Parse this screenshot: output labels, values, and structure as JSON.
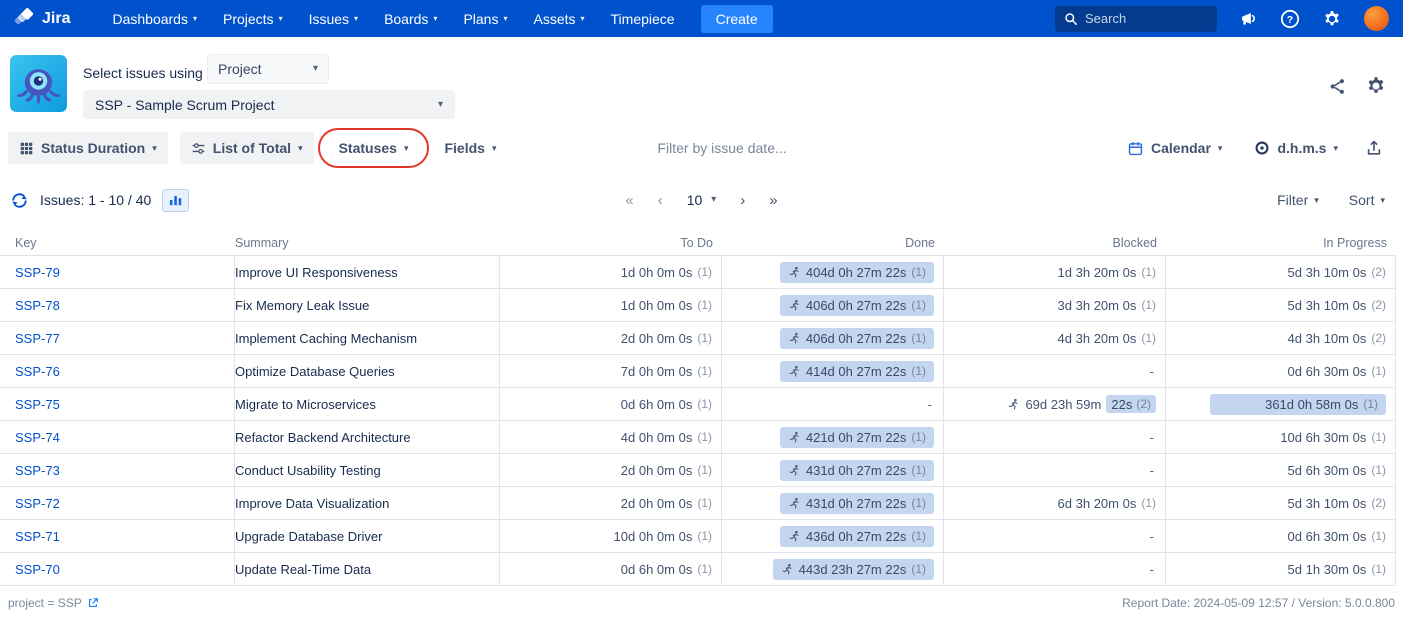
{
  "nav": {
    "brand": "Jira",
    "items": [
      {
        "label": "Dashboards",
        "dropdown": true
      },
      {
        "label": "Projects",
        "dropdown": true
      },
      {
        "label": "Issues",
        "dropdown": true
      },
      {
        "label": "Boards",
        "dropdown": true
      },
      {
        "label": "Plans",
        "dropdown": true
      },
      {
        "label": "Assets",
        "dropdown": true
      },
      {
        "label": "Timepiece",
        "dropdown": false
      }
    ],
    "create_label": "Create",
    "search_placeholder": "Search"
  },
  "header": {
    "select_issues_label": "Select issues using",
    "issue_source": "Project",
    "project": "SSP - Sample Scrum Project"
  },
  "toolbar": {
    "status_duration": "Status Duration",
    "list_of_total": "List of Total",
    "statuses": "Statuses",
    "fields": "Fields",
    "date_filter_placeholder": "Filter by issue date...",
    "calendar": "Calendar",
    "time_format": "d.h.m.s"
  },
  "pagination": {
    "issues_label": "Issues: 1 - 10 / 40",
    "page_size": "10",
    "filter_label": "Filter",
    "sort_label": "Sort"
  },
  "table": {
    "columns": [
      "Key",
      "Summary",
      "To Do",
      "Done",
      "Blocked",
      "In Progress"
    ],
    "rows": [
      {
        "key": "SSP-79",
        "summary": "Improve UI Responsiveness",
        "todo": {
          "text": "1d 0h 0m 0s",
          "count": "(1)"
        },
        "done": {
          "text": "404d 0h 27m 22s",
          "count": "(1)",
          "runner": true,
          "pill": "blue"
        },
        "blocked": {
          "text": "1d 3h 20m 0s",
          "count": "(1)"
        },
        "in_progress": {
          "text": "5d 3h 10m 0s",
          "count": "(2)"
        }
      },
      {
        "key": "SSP-78",
        "summary": "Fix Memory Leak Issue",
        "todo": {
          "text": "1d 0h 0m 0s",
          "count": "(1)"
        },
        "done": {
          "text": "406d 0h 27m 22s",
          "count": "(1)",
          "runner": true,
          "pill": "blue"
        },
        "blocked": {
          "text": "3d 3h 20m 0s",
          "count": "(1)"
        },
        "in_progress": {
          "text": "5d 3h 10m 0s",
          "count": "(2)"
        }
      },
      {
        "key": "SSP-77",
        "summary": "Implement Caching Mechanism",
        "todo": {
          "text": "2d 0h 0m 0s",
          "count": "(1)"
        },
        "done": {
          "text": "406d 0h 27m 22s",
          "count": "(1)",
          "runner": true,
          "pill": "blue"
        },
        "blocked": {
          "text": "4d 3h 20m 0s",
          "count": "(1)"
        },
        "in_progress": {
          "text": "4d 3h 10m 0s",
          "count": "(2)"
        }
      },
      {
        "key": "SSP-76",
        "summary": "Optimize Database Queries",
        "todo": {
          "text": "7d 0h 0m 0s",
          "count": "(1)"
        },
        "done": {
          "text": "414d 0h 27m 22s",
          "count": "(1)",
          "runner": true,
          "pill": "blue"
        },
        "blocked": {
          "text": "-"
        },
        "in_progress": {
          "text": "0d 6h 30m 0s",
          "count": "(1)"
        }
      },
      {
        "key": "SSP-75",
        "summary": "Migrate to Microservices",
        "todo": {
          "text": "0d 6h 0m 0s",
          "count": "(1)"
        },
        "done": {
          "text": "-"
        },
        "blocked": {
          "text": "69d 23h 59m",
          "hl": "22s",
          "count": "(2)",
          "runner": true
        },
        "in_progress": {
          "text": "361d 0h 58m 0s",
          "count": "(1)",
          "pill": "blue",
          "wide": true
        }
      },
      {
        "key": "SSP-74",
        "summary": "Refactor Backend Architecture",
        "todo": {
          "text": "4d 0h 0m 0s",
          "count": "(1)"
        },
        "done": {
          "text": "421d 0h 27m 22s",
          "count": "(1)",
          "runner": true,
          "pill": "blue"
        },
        "blocked": {
          "text": "-"
        },
        "in_progress": {
          "text": "10d 6h 30m 0s",
          "count": "(1)"
        }
      },
      {
        "key": "SSP-73",
        "summary": "Conduct Usability Testing",
        "todo": {
          "text": "2d 0h 0m 0s",
          "count": "(1)"
        },
        "done": {
          "text": "431d 0h 27m 22s",
          "count": "(1)",
          "runner": true,
          "pill": "blue"
        },
        "blocked": {
          "text": "-"
        },
        "in_progress": {
          "text": "5d 6h 30m 0s",
          "count": "(1)"
        }
      },
      {
        "key": "SSP-72",
        "summary": "Improve Data Visualization",
        "todo": {
          "text": "2d 0h 0m 0s",
          "count": "(1)"
        },
        "done": {
          "text": "431d 0h 27m 22s",
          "count": "(1)",
          "runner": true,
          "pill": "blue"
        },
        "blocked": {
          "text": "6d 3h 20m 0s",
          "count": "(1)"
        },
        "in_progress": {
          "text": "5d 3h 10m 0s",
          "count": "(2)"
        }
      },
      {
        "key": "SSP-71",
        "summary": "Upgrade Database Driver",
        "todo": {
          "text": "10d 0h 0m 0s",
          "count": "(1)"
        },
        "done": {
          "text": "436d 0h 27m 22s",
          "count": "(1)",
          "runner": true,
          "pill": "blue"
        },
        "blocked": {
          "text": "-"
        },
        "in_progress": {
          "text": "0d 6h 30m 0s",
          "count": "(1)"
        }
      },
      {
        "key": "SSP-70",
        "summary": "Update Real-Time Data",
        "todo": {
          "text": "0d 6h 0m 0s",
          "count": "(1)"
        },
        "done": {
          "text": "443d 23h 27m 22s",
          "count": "(1)",
          "runner": true,
          "pill": "blue"
        },
        "blocked": {
          "text": "-"
        },
        "in_progress": {
          "text": "5d 1h 30m 0s",
          "count": "(1)"
        }
      }
    ]
  },
  "footer": {
    "query": "project = SSP",
    "report_info": "Report Date: 2024-05-09 12:57 / Version: 5.0.0.800"
  },
  "colors": {
    "nav_bg": "#0052CC",
    "create_button": "#2684FF",
    "pill_bg": "#C4D6EF",
    "link": "#0052CC",
    "annotation_red": "#E2362A",
    "border": "#E2E4E9"
  }
}
